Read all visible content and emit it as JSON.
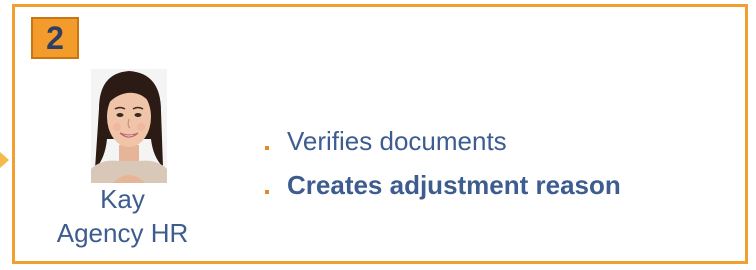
{
  "step": {
    "number": "2"
  },
  "person": {
    "name": "Kay",
    "role": "Agency HR"
  },
  "tasks": [
    {
      "text": "Verifies documents",
      "emphasis": false
    },
    {
      "text": "Creates adjustment reason",
      "emphasis": true
    }
  ],
  "colors": {
    "frame": "#f0a030",
    "badge": "#f39c2c",
    "text": "#3d5c8f",
    "bullet": "#e08a2c"
  },
  "icons": {
    "avatar": "person-photo-icon",
    "connector": "arrow-tip-icon"
  }
}
